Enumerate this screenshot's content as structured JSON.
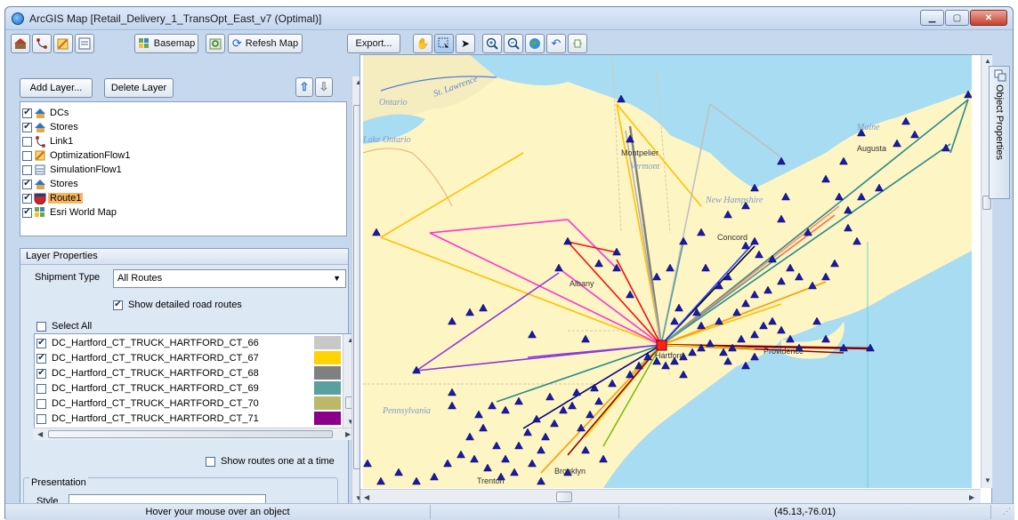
{
  "window": {
    "title": "ArcGIS Map [Retail_Delivery_1_TransOpt_East_v7 (Optimal)]",
    "controls": {
      "minimize": "▁",
      "maximize": "▢",
      "close": "✕"
    }
  },
  "toolbar": {
    "basemap_label": "Basemap",
    "refresh_label": "Refesh Map",
    "export_label": "Export...",
    "icons": [
      "map-home-icon",
      "link-icon",
      "edit-icon",
      "list-icon",
      "basemap-icon",
      "refresh-map-icon",
      "pan-hand-icon",
      "select-box-icon",
      "pointer-icon",
      "zoom-in-icon",
      "zoom-out-icon",
      "full-extent-icon",
      "undo-icon",
      "plugin-icon"
    ]
  },
  "layers_panel": {
    "add_label": "Add Layer...",
    "delete_label": "Delete Layer",
    "layers": [
      {
        "label": "DCs",
        "checked": true,
        "icon": "house-icon"
      },
      {
        "label": "Stores",
        "checked": true,
        "icon": "house-icon"
      },
      {
        "label": "Link1",
        "checked": false,
        "icon": "link-icon"
      },
      {
        "label": "OptimizationFlow1",
        "checked": false,
        "icon": "flow-icon"
      },
      {
        "label": "SimulationFlow1",
        "checked": false,
        "icon": "list-icon"
      },
      {
        "label": "Stores",
        "checked": true,
        "icon": "house-icon"
      },
      {
        "label": "Route1",
        "checked": true,
        "icon": "route-shield-icon",
        "selected": true
      },
      {
        "label": "Esri World Map",
        "checked": true,
        "icon": "grid-map-icon"
      }
    ]
  },
  "layer_properties": {
    "heading": "Layer Properties",
    "shipment_type_label": "Shipment Type",
    "shipment_type_value": "All Routes",
    "show_detailed_label": "Show detailed road routes",
    "show_detailed_checked": true,
    "select_all_label": "Select All",
    "select_all_checked": false,
    "routes": [
      {
        "label": "DC_Hartford_CT_TRUCK_HARTFORD_CT_66",
        "checked": true,
        "color": "#c8c8c8"
      },
      {
        "label": "DC_Hartford_CT_TRUCK_HARTFORD_CT_67",
        "checked": true,
        "color": "#ffd400"
      },
      {
        "label": "DC_Hartford_CT_TRUCK_HARTFORD_CT_68",
        "checked": true,
        "color": "#808080"
      },
      {
        "label": "DC_Hartford_CT_TRUCK_HARTFORD_CT_69",
        "checked": false,
        "color": "#5aa0a0"
      },
      {
        "label": "DC_Hartford_CT_TRUCK_HARTFORD_CT_70",
        "checked": false,
        "color": "#bdb76b"
      },
      {
        "label": "DC_Hartford_CT_TRUCK_HARTFORD_CT_71",
        "checked": false,
        "color": "#8b008b"
      }
    ],
    "show_one_at_a_time_label": "Show routes one at a time",
    "presentation_label": "Presentation",
    "style_label": "Style"
  },
  "map": {
    "labels": {
      "ontario": "Ontario",
      "st_lawrence": "St. Lawrence",
      "lake_ontario": "Lake Ontario",
      "vermont": "Vermont",
      "maine": "Maine",
      "new_hampshire": "New Hampshire",
      "pennsylvania": "Pennsylvania"
    },
    "cities": {
      "montpelier": "Montpelier",
      "augusta": "Augusta",
      "concord": "Concord",
      "albany": "Albany",
      "hartford": "Hartford",
      "providence": "Providence",
      "brooklyn": "Brooklyn",
      "trenton": "Trenton"
    }
  },
  "side_tab": {
    "label": "Object Properties"
  },
  "status_bar": {
    "hover_text": "Hover your mouse over an object",
    "coordinates": "(45.13,-76.01)"
  }
}
